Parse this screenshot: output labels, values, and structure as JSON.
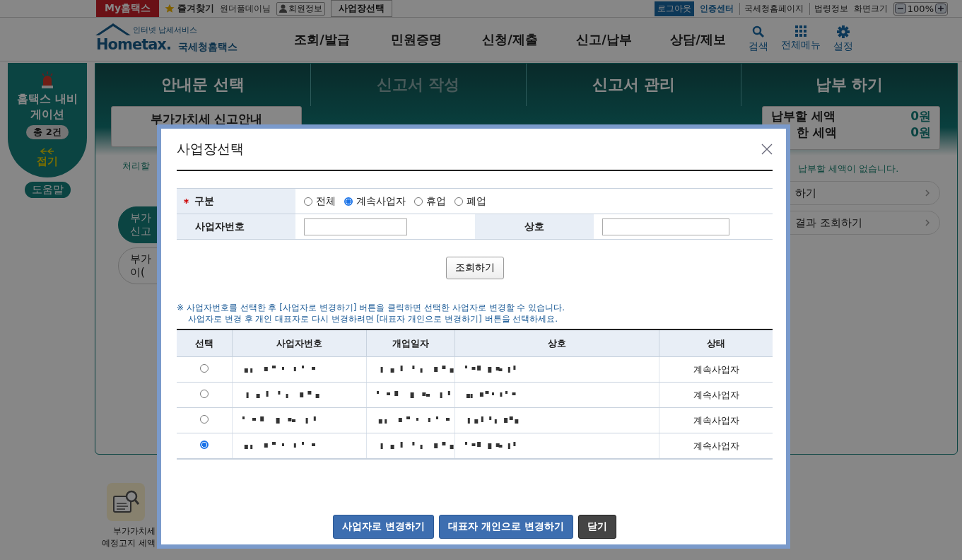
{
  "top_bar": {
    "my_hometax": "My홈택스",
    "favorites": "즐겨찾기",
    "user": "원더풀데이님",
    "member_info": "회원정보",
    "business_select": "사업장선택",
    "logout": "로그아웃",
    "cert_center": "인증센터",
    "links": [
      "국세청홈페이지",
      "법령정보"
    ],
    "zoom_label": "화면크기",
    "zoom_value": "100%"
  },
  "header": {
    "logo_tagline": "인터넷 납세서비스",
    "logo_text": "Hometax.",
    "logo_name": "국세청홈택스",
    "nav": [
      "조회/발급",
      "민원증명",
      "신청/제출",
      "신고/납부",
      "상담/제보"
    ],
    "tools": [
      {
        "label": "검색",
        "kind": "search"
      },
      {
        "label": "전체메뉴",
        "kind": "grid"
      },
      {
        "label": "설정",
        "kind": "gear"
      }
    ]
  },
  "sidebar": {
    "title": "홈택스 내비게이션",
    "count": "총 2건",
    "fold": "접기",
    "help": "도움말"
  },
  "steps": [
    {
      "title": "안내문 선택",
      "disabled": false
    },
    {
      "title": "신고서 작성",
      "disabled": true
    },
    {
      "title": "신고서 관리",
      "disabled": false
    },
    {
      "title": "납부 하기",
      "disabled": false
    }
  ],
  "notice_card": "부가가치세 신고안내",
  "notice_note": "처리할",
  "pills_left": [
    {
      "lines": [
        "부가",
        "신고"
      ],
      "selected": true
    },
    {
      "lines": [
        "부가",
        "이("
      ],
      "selected": false
    }
  ],
  "payment": [
    {
      "label": "납부할 세액",
      "amount": "0원"
    },
    {
      "label": "한 세액",
      "amount": "0원"
    }
  ],
  "payment_note": "납부할 세액이 없습니다.",
  "pills_right": [
    "하기",
    "결과 조회하기"
  ],
  "bottom_item": {
    "lines": [
      "부가가치세",
      "예정고지 세액"
    ]
  },
  "modal": {
    "title": "사업장선택",
    "form": {
      "category_label": "구분",
      "required": true,
      "options": [
        {
          "label": "전체",
          "selected": false
        },
        {
          "label": "계속사업자",
          "selected": true
        },
        {
          "label": "휴업",
          "selected": false
        },
        {
          "label": "폐업",
          "selected": false
        }
      ],
      "bizno_label": "사업자번호",
      "name_label": "상호"
    },
    "search_button": "조회하기",
    "notes": [
      "※ 사업자번호를 선택한 후 [사업자로 변경하기] 버튼을 클릭하면 선택한 사업자로 변경할 수 있습니다.",
      "사업자로 변경 후 개인 대표자로 다시 변경하려면 [대표자 개인으로 변경하기] 버튼을 선택하세요."
    ],
    "columns": [
      "선택",
      "사업자번호",
      "개업일자",
      "상호",
      "상태"
    ],
    "rows": [
      {
        "selected": false,
        "status": "계속사업자"
      },
      {
        "selected": false,
        "status": "계속사업자"
      },
      {
        "selected": false,
        "status": "계속사업자"
      },
      {
        "selected": true,
        "status": "계속사업자"
      }
    ],
    "buttons": [
      {
        "label": "사업자로 변경하기",
        "kind": "primary"
      },
      {
        "label": "대표자 개인으로 변경하기",
        "kind": "primary"
      },
      {
        "label": "닫기",
        "kind": "dark"
      }
    ]
  }
}
